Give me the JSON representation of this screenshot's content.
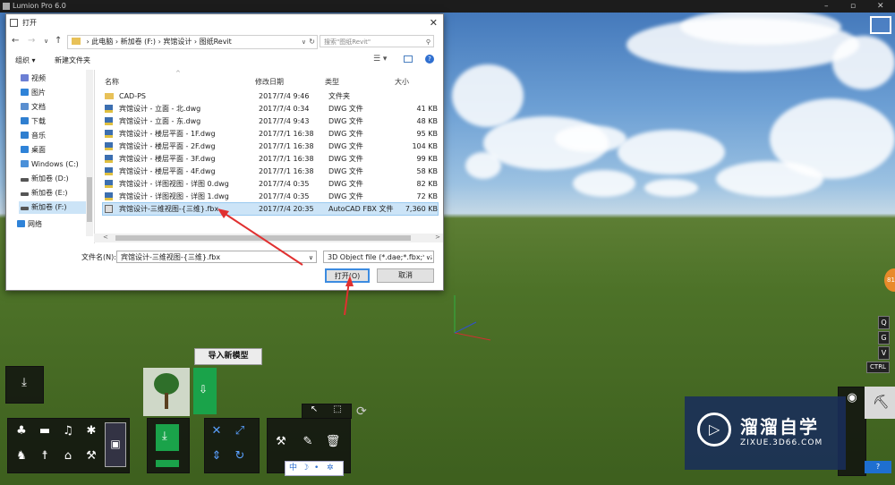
{
  "app": {
    "title": "Lumion Pro 6.0",
    "controls": [
      "–",
      "▫",
      "✕"
    ]
  },
  "dialog": {
    "title": "打开",
    "address": {
      "crumbs": [
        "此电脑",
        "新加卷 (F:)",
        "宾馆设计",
        "图纸Revit"
      ],
      "path_text": "› 此电脑 › 新加卷 (F:) › 宾馆设计 › 图纸Revit"
    },
    "search_placeholder": "搜索\"图纸Revit\"",
    "toolbar": {
      "organize": "组织 ▾",
      "new_folder": "新建文件夹"
    },
    "sidebar": [
      {
        "label": "视频",
        "color": "#6c7fd4"
      },
      {
        "label": "图片",
        "color": "#2f83d8"
      },
      {
        "label": "文档",
        "color": "#5a8fd0"
      },
      {
        "label": "下载",
        "color": "#2f7fd0"
      },
      {
        "label": "音乐",
        "color": "#2f7fd0"
      },
      {
        "label": "桌面",
        "color": "#2f83d8"
      },
      {
        "label": "Windows (C:)",
        "color": "#4a90d9"
      },
      {
        "label": "新加卷 (D:)",
        "color": "#555555"
      },
      {
        "label": "新加卷 (E:)",
        "color": "#555555"
      },
      {
        "label": "新加卷 (F:)",
        "color": "#555555"
      },
      {
        "label": "网络",
        "color": "#2f83d8"
      }
    ],
    "columns": {
      "name": "名称",
      "date": "修改日期",
      "type": "类型",
      "size": "大小"
    },
    "files": [
      {
        "name": "CAD-PS",
        "date": "2017/7/4 9:46",
        "type": "文件夹",
        "size": "",
        "kind": "folder"
      },
      {
        "name": "宾馆设计 - 立面 - 北.dwg",
        "date": "2017/7/4 0:34",
        "type": "DWG 文件",
        "size": "41 KB",
        "kind": "dwg"
      },
      {
        "name": "宾馆设计 - 立面 - 东.dwg",
        "date": "2017/7/4 9:43",
        "type": "DWG 文件",
        "size": "48 KB",
        "kind": "dwg"
      },
      {
        "name": "宾馆设计 - 楼层平面 - 1F.dwg",
        "date": "2017/7/1 16:38",
        "type": "DWG 文件",
        "size": "95 KB",
        "kind": "dwg"
      },
      {
        "name": "宾馆设计 - 楼层平面 - 2F.dwg",
        "date": "2017/7/1 16:38",
        "type": "DWG 文件",
        "size": "104 KB",
        "kind": "dwg"
      },
      {
        "name": "宾馆设计 - 楼层平面 - 3F.dwg",
        "date": "2017/7/1 16:38",
        "type": "DWG 文件",
        "size": "99 KB",
        "kind": "dwg"
      },
      {
        "name": "宾馆设计 - 楼层平面 - 4F.dwg",
        "date": "2017/7/1 16:38",
        "type": "DWG 文件",
        "size": "58 KB",
        "kind": "dwg"
      },
      {
        "name": "宾馆设计 - 详图视图 - 详图 0.dwg",
        "date": "2017/7/4 0:35",
        "type": "DWG 文件",
        "size": "82 KB",
        "kind": "dwg"
      },
      {
        "name": "宾馆设计 - 详图视图 - 详图 1.dwg",
        "date": "2017/7/4 0:35",
        "type": "DWG 文件",
        "size": "72 KB",
        "kind": "dwg"
      },
      {
        "name": "宾馆设计-三维视图-{三维}.fbx",
        "date": "2017/7/4 20:35",
        "type": "AutoCAD FBX 文件",
        "size": "7,360 KB",
        "kind": "fbx"
      }
    ],
    "filename_label": "文件名(N):",
    "filename_value": "宾馆设计-三维视图-{三维}.fbx",
    "filetype_value": "3D Object file (*.dae;*.fbx;*.s",
    "open_button": "打开(O)",
    "cancel_button": "取消"
  },
  "lumion": {
    "import_label": "导入新模型",
    "nav_keys": [
      "Q",
      "G",
      "V",
      "CTRL"
    ],
    "weather": "中",
    "badge": "81"
  },
  "watermark": {
    "title": "溜溜自学",
    "url": "ZIXUE.3D66.COM"
  }
}
